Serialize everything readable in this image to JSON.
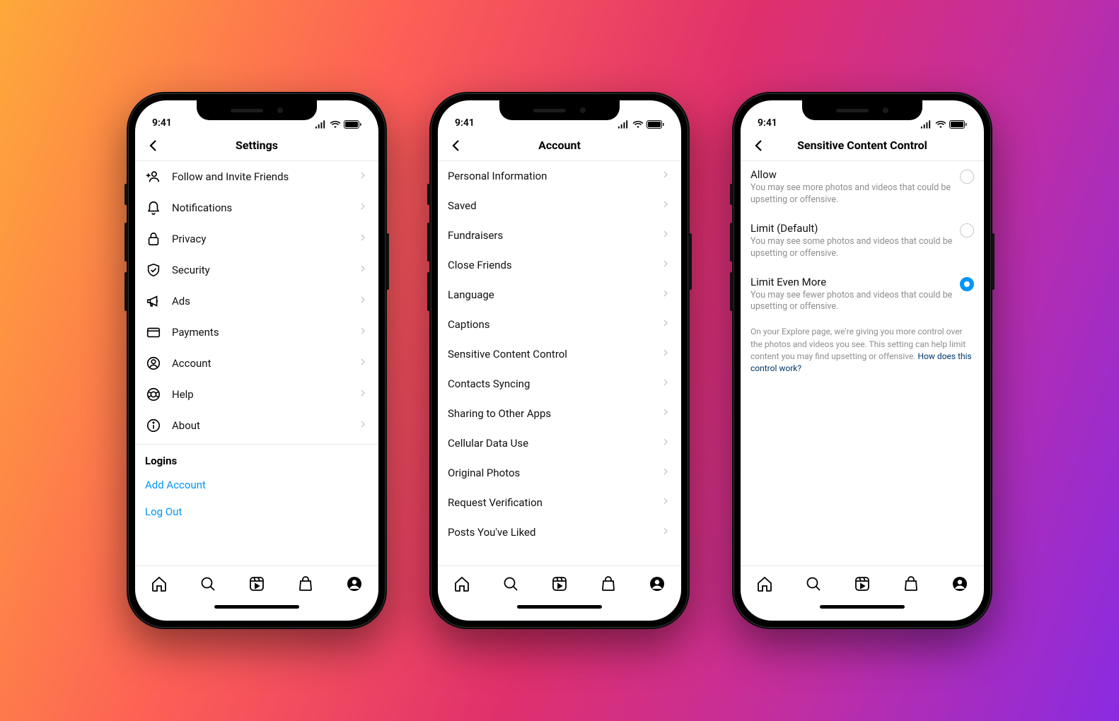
{
  "status": {
    "time": "9:41"
  },
  "phones": [
    {
      "title": "Settings",
      "show_icons": true,
      "items": [
        {
          "icon": "user-plus",
          "label": "Follow and Invite Friends"
        },
        {
          "icon": "bell",
          "label": "Notifications"
        },
        {
          "icon": "lock",
          "label": "Privacy"
        },
        {
          "icon": "shield",
          "label": "Security"
        },
        {
          "icon": "megaphone",
          "label": "Ads"
        },
        {
          "icon": "card",
          "label": "Payments"
        },
        {
          "icon": "person",
          "label": "Account"
        },
        {
          "icon": "lifebuoy",
          "label": "Help"
        },
        {
          "icon": "info",
          "label": "About"
        }
      ],
      "section_title": "Logins",
      "links": [
        "Add Account",
        "Log Out"
      ]
    },
    {
      "title": "Account",
      "show_icons": false,
      "items": [
        {
          "label": "Personal Information"
        },
        {
          "label": "Saved"
        },
        {
          "label": "Fundraisers"
        },
        {
          "label": "Close Friends"
        },
        {
          "label": "Language"
        },
        {
          "label": "Captions"
        },
        {
          "label": "Sensitive Content Control"
        },
        {
          "label": "Contacts Syncing"
        },
        {
          "label": "Sharing to Other Apps"
        },
        {
          "label": "Cellular Data Use"
        },
        {
          "label": "Original Photos"
        },
        {
          "label": "Request Verification"
        },
        {
          "label": "Posts You've Liked"
        }
      ]
    },
    {
      "title": "Sensitive Content Control",
      "options": [
        {
          "title": "Allow",
          "desc": "You may see more photos and videos that could be upsetting or offensive.",
          "selected": false
        },
        {
          "title": "Limit (Default)",
          "desc": "You may see some photos and videos that could be upsetting or offensive.",
          "selected": false
        },
        {
          "title": "Limit Even More",
          "desc": "You may see fewer photos and videos that could be upsetting or offensive.",
          "selected": true
        }
      ],
      "info": "On your Explore page, we're giving you more control over the photos and videos you see. This setting can help limit content you may find upsetting or offensive. ",
      "info_link": "How does this control work?"
    }
  ]
}
